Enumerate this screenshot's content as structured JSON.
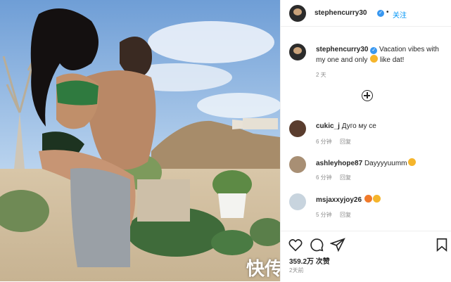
{
  "post": {
    "username": "stephencurry30",
    "follow_label": "关注",
    "separator": "•",
    "caption_text": "Vacation vibes with my one and only",
    "caption_suffix": " like dat!",
    "caption_time": "2 天",
    "comments": [
      {
        "user": "cukic_j",
        "text": "Дуго му се",
        "time": "6 分钟",
        "reply": "回复"
      },
      {
        "user": "ashleyhope87",
        "text": "Dayyyyuumm",
        "time": "6 分钟",
        "reply": "回复"
      },
      {
        "user": "msjaxxyjoy26",
        "text": "",
        "time": "5 分钟",
        "reply": "回复"
      }
    ],
    "likes": "359.2万 次赞",
    "date": "2天前"
  },
  "watermark": "快传",
  "icons": {
    "like": "heart-icon",
    "comment": "comment-icon",
    "share": "share-icon",
    "save": "bookmark-icon",
    "load_more": "plus-circle-icon",
    "verified": "verified-badge-icon"
  },
  "colors": {
    "link": "#0095f6",
    "verified": "#3897f0",
    "muted": "#8e8e8e",
    "text": "#262626"
  }
}
